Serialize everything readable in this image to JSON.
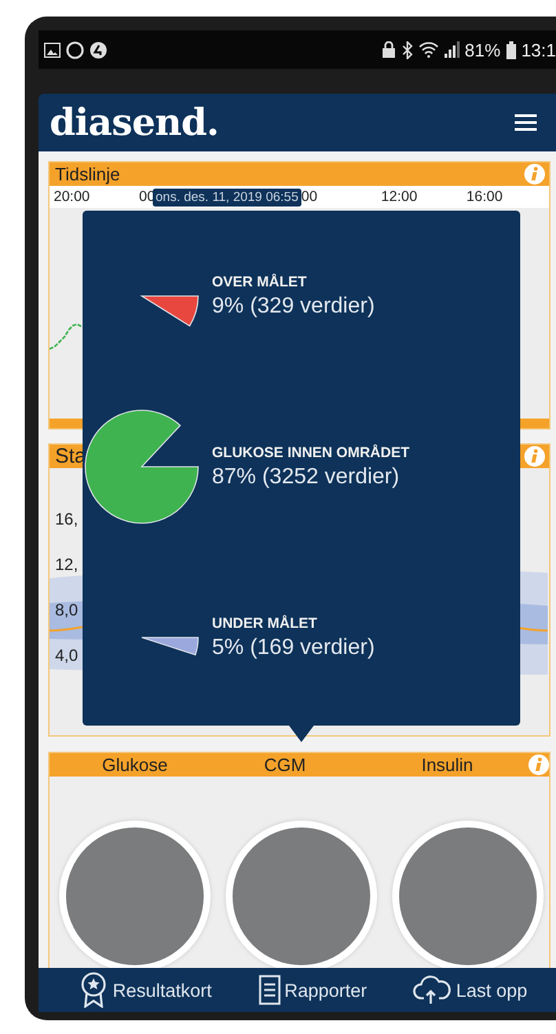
{
  "status_bar": {
    "battery": "81%",
    "time": "13:1"
  },
  "header": {
    "logo": "diasend."
  },
  "timeline": {
    "title": "Tidslinje",
    "axis_labels_before": [
      "20:00",
      "00"
    ],
    "date_tooltip": "ons. des. 11, 2019 06:55",
    "axis_labels_after": [
      "00",
      "12:00",
      "16:00"
    ]
  },
  "statistics": {
    "title": "Sta",
    "y_labels": [
      "16,",
      "12,",
      "8,0",
      "4,0"
    ]
  },
  "popup": {
    "items": [
      {
        "kind": "over",
        "label": "OVER MÅLET",
        "value": "9% (329 verdier)",
        "color": "#e8473f"
      },
      {
        "kind": "in_range",
        "label": "GLUKOSE INNEN OMRÅDET",
        "value": "87% (3252 verdier)",
        "color": "#3fb34f"
      },
      {
        "kind": "under",
        "label": "UNDER MÅLET",
        "value": "5% (169 verdier)",
        "color": "#9aa8dd"
      }
    ]
  },
  "results": {
    "columns": [
      "Glukose",
      "CGM",
      "Insulin"
    ]
  },
  "bottom_nav": [
    {
      "kind": "scorecard",
      "label": "Resultatkort"
    },
    {
      "kind": "reports",
      "label": "Rapporter"
    },
    {
      "kind": "upload",
      "label": "Last opp"
    }
  ]
}
